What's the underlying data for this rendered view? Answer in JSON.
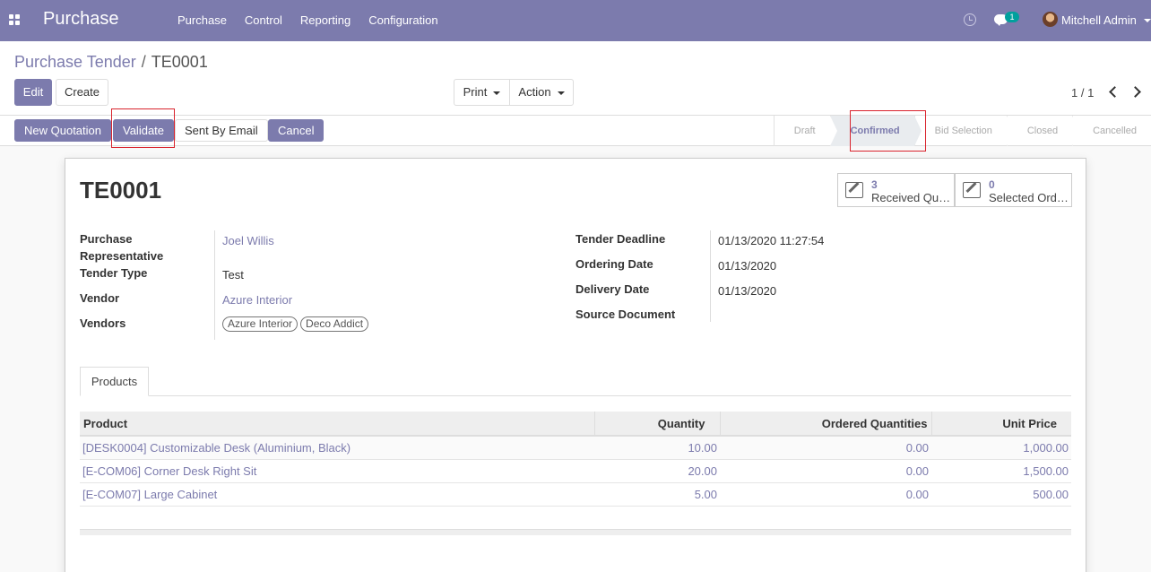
{
  "navbar": {
    "brand": "Purchase",
    "menu": [
      "Purchase",
      "Control",
      "Reporting",
      "Configuration"
    ],
    "chat_count": "1",
    "user": "Mitchell Admin"
  },
  "control": {
    "breadcrumb_parent": "Purchase Tender",
    "breadcrumb_sep": "/",
    "breadcrumb_current": "TE0001",
    "edit_label": "Edit",
    "create_label": "Create",
    "print_label": "Print",
    "action_label": "Action",
    "pager": "1 / 1"
  },
  "statusbar": {
    "buttons": [
      "New Quotation",
      "Validate",
      "Sent By Email",
      "Cancel"
    ],
    "stages": [
      "Draft",
      "Confirmed",
      "Bid Selection",
      "Closed",
      "Cancelled"
    ],
    "active_stage": "Confirmed"
  },
  "form": {
    "name": "TE0001",
    "smart_buttons": [
      {
        "count": "3",
        "label": "Received Quotations"
      },
      {
        "count": "0",
        "label": "Selected Orders"
      }
    ],
    "left_fields": {
      "rep_label": "Purchase Representative",
      "rep_value": "Joel Willis",
      "type_label": "Tender Type",
      "type_value": "Test",
      "vendor_label": "Vendor",
      "vendor_value": "Azure Interior",
      "vendors_label": "Vendors",
      "vendors_tags": [
        "Azure Interior",
        "Deco Addict"
      ]
    },
    "right_fields": {
      "deadline_label": "Tender Deadline",
      "deadline_value": "01/13/2020 11:27:54",
      "ordering_label": "Ordering Date",
      "ordering_value": "01/13/2020",
      "delivery_label": "Delivery Date",
      "delivery_value": "01/13/2020",
      "source_label": "Source Document",
      "source_value": ""
    },
    "tab": "Products",
    "table": {
      "headers": [
        "Product",
        "Quantity",
        "Ordered Quantities",
        "Unit Price"
      ],
      "rows": [
        [
          "[DESK0004] Customizable Desk (Aluminium, Black)",
          "10.00",
          "0.00",
          "1,000.00"
        ],
        [
          "[E-COM06] Corner Desk Right Sit",
          "20.00",
          "0.00",
          "1,500.00"
        ],
        [
          "[E-COM07] Large Cabinet",
          "5.00",
          "0.00",
          "500.00"
        ]
      ]
    }
  },
  "colors": {
    "brand": "#7c7bad",
    "highlight": "#d9232d"
  }
}
